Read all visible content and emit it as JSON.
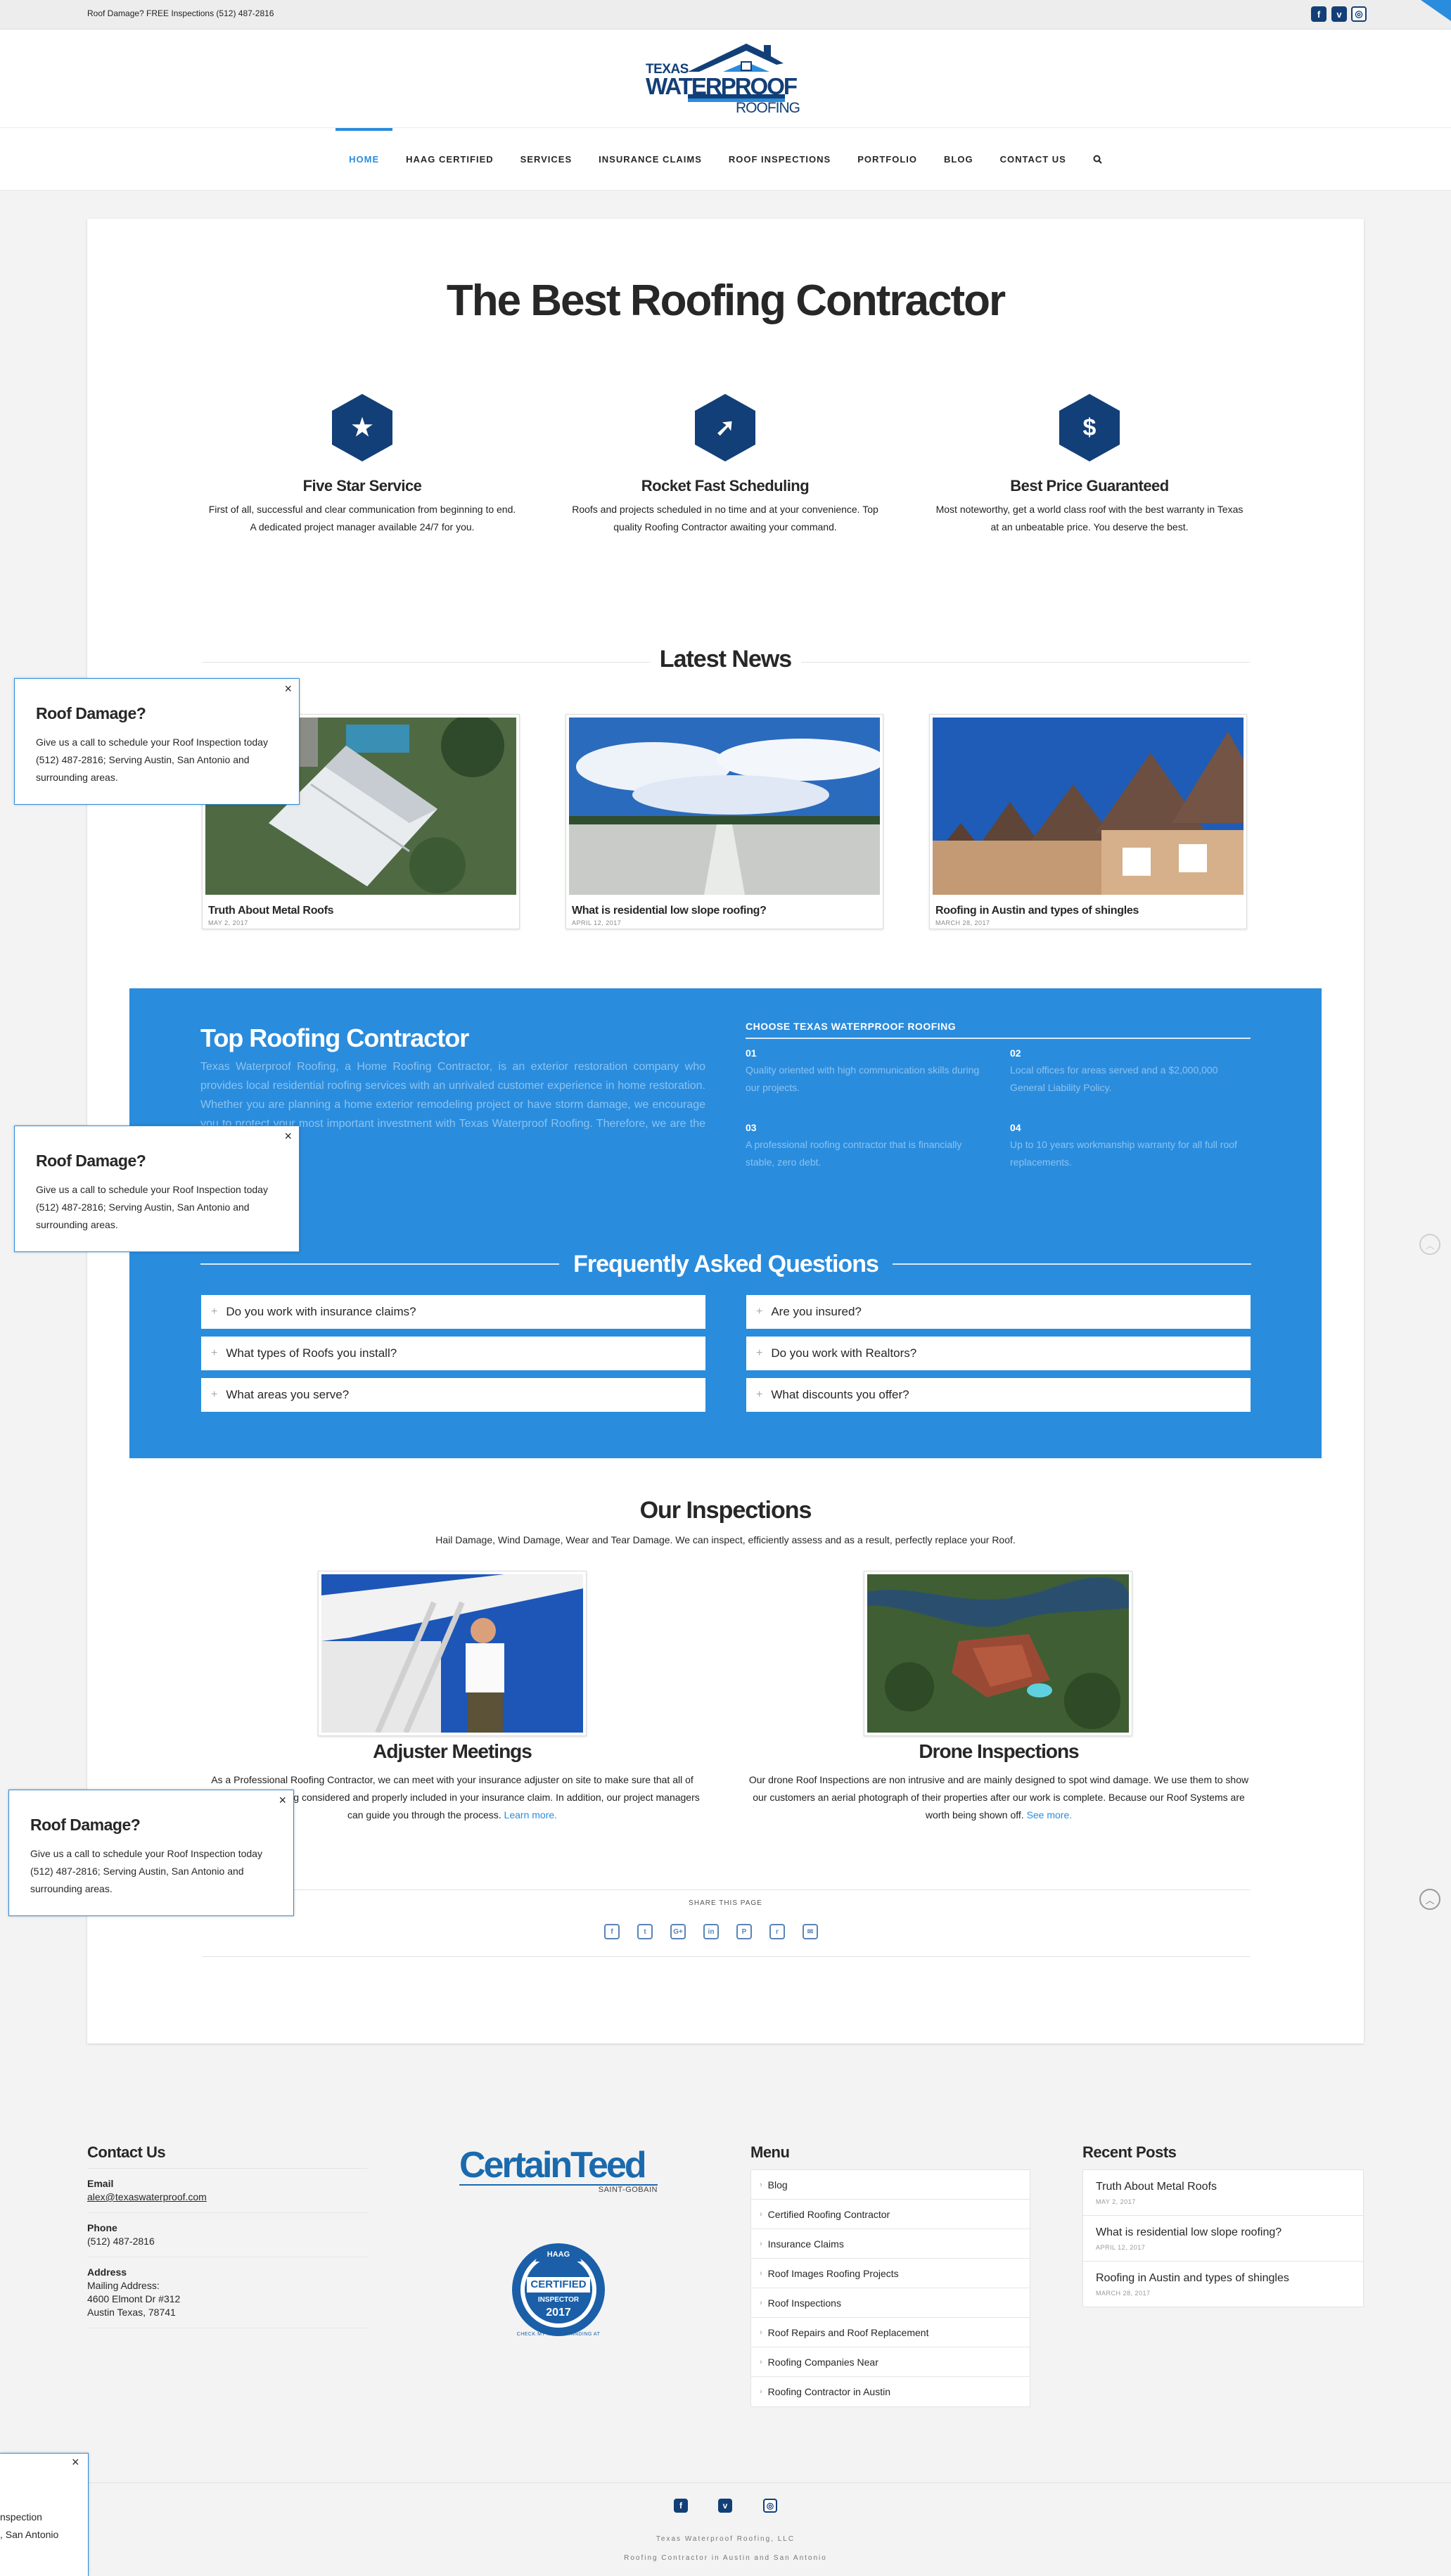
{
  "topbar": {
    "message": "Roof Damage? FREE Inspections (512) 487-2816",
    "social": [
      {
        "icon": "facebook-icon",
        "glyph": "f"
      },
      {
        "icon": "vimeo-icon",
        "glyph": "v"
      },
      {
        "icon": "instagram-icon",
        "glyph": "◎"
      }
    ]
  },
  "logo": {
    "line1": "TEXAS",
    "line2": "WATERPROOF",
    "line3": "ROOFING"
  },
  "nav": [
    "HOME",
    "HAAG CERTIFIED",
    "SERVICES",
    "INSURANCE CLAIMS",
    "ROOF INSPECTIONS",
    "PORTFOLIO",
    "BLOG",
    "CONTACT US"
  ],
  "hero": {
    "title": "The Best Roofing Contractor"
  },
  "features": [
    {
      "icon": "star-icon",
      "glyph": "★",
      "title": "Five Star Service",
      "text": "First of all, successful and clear communication from beginning to end. A dedicated project manager available 24/7 for you."
    },
    {
      "icon": "rocket-icon",
      "glyph": "➚",
      "title": "Rocket Fast Scheduling",
      "text": "Roofs and projects scheduled in no time and at your convenience. Top quality Roofing Contractor awaiting your command."
    },
    {
      "icon": "dollar-icon",
      "glyph": "$",
      "title": "Best Price Guaranteed",
      "text": "Most noteworthy, get a world class roof with the best warranty in Texas at an unbeatable price. You deserve the best."
    }
  ],
  "news": {
    "title": "Latest News",
    "posts": [
      {
        "title": "Truth About Metal Roofs",
        "date": "MAY 2, 2017"
      },
      {
        "title": "What is residential low slope roofing?",
        "date": "APRIL 12, 2017"
      },
      {
        "title": "Roofing in Austin and types of shingles",
        "date": "MARCH 28, 2017"
      }
    ]
  },
  "contractor": {
    "title": "Top Roofing Contractor",
    "text": "Texas Waterproof Roofing, a Home Roofing Contractor, is an exterior restoration company who provides local residential roofing services with an unrivaled customer experience in home restoration. Whether you are planning a home exterior remodeling project or have storm damage, we encourage you to protect your most important investment with Texas Waterproof Roofing. Therefore, we are the best roofer in town.",
    "choose_title": "CHOOSE TEXAS WATERPROOF ROOFING",
    "reasons": [
      {
        "num": "01",
        "text": "Quality oriented with high communication skills during our projects."
      },
      {
        "num": "02",
        "text": "Local offices for areas served and a $2,000,000 General Liability Policy."
      },
      {
        "num": "03",
        "text": "A professional roofing contractor that is financially stable, zero debt."
      },
      {
        "num": "04",
        "text": "Up to 10 years workmanship warranty for all full roof replacements."
      }
    ]
  },
  "faq": {
    "title": "Frequently Asked Questions",
    "items": [
      "Do you work with insurance claims?",
      "Are you insured?",
      "What types of Roofs you install?",
      "Do you work with Realtors?",
      "What areas you serve?",
      "What discounts you offer?"
    ]
  },
  "inspections": {
    "title": "Our Inspections",
    "subtitle": "Hail Damage, Wind Damage, Wear and Tear Damage. We can inspect, efficiently assess and as a result, perfectly replace your Roof.",
    "items": [
      {
        "title": "Adjuster Meetings",
        "text": "As a Professional Roofing Contractor, we can meet with your insurance adjuster on site to make sure that all of your damage is being considered and properly included in your insurance claim. In addition, our project managers can guide you through the process.",
        "link": "Learn more."
      },
      {
        "title": "Drone Inspections",
        "text": "Our drone Roof Inspections are non intrusive and are mainly designed to spot wind damage. We use them to show our customers an aerial photograph of their properties after our work is complete. Because our Roof Systems are worth being shown off.",
        "link": "See more."
      }
    ]
  },
  "share": {
    "label": "SHARE THIS PAGE",
    "icons": [
      {
        "icon": "facebook-share-icon",
        "glyph": "f"
      },
      {
        "icon": "twitter-share-icon",
        "glyph": "t"
      },
      {
        "icon": "google-plus-share-icon",
        "glyph": "G+"
      },
      {
        "icon": "linkedin-share-icon",
        "glyph": "in"
      },
      {
        "icon": "pinterest-share-icon",
        "glyph": "P"
      },
      {
        "icon": "reddit-share-icon",
        "glyph": "r"
      },
      {
        "icon": "email-share-icon",
        "glyph": "✉"
      }
    ]
  },
  "popup": {
    "title": "Roof Damage?",
    "text": "Give us a call to schedule your Roof Inspection today (512) 487-2816; Serving Austin, San Antonio and surrounding areas.",
    "close": "×",
    "clipped_lines": [
      "nspection",
      ", San Antonio"
    ]
  },
  "footer": {
    "contact": {
      "title": "Contact Us",
      "email_label": "Email",
      "email": "alex@texaswaterproof.com",
      "phone_label": "Phone",
      "phone": "(512) 487-2816",
      "address_label": "Address",
      "address_lines": [
        "Mailing Address:",
        "4600 Elmont Dr #312",
        "Austin Texas, 78741"
      ]
    },
    "certainteed": {
      "name": "CertainTeed",
      "sub": "SAINT-GOBAIN"
    },
    "haag": {
      "top": "HAAG",
      "line1": "CERTIFIED",
      "line2": "INSPECTOR",
      "year": "2017",
      "ring": "CHECK MY HAAG STANDING AT"
    },
    "menu": {
      "title": "Menu",
      "items": [
        "Blog",
        "Certified Roofing Contractor",
        "Insurance Claims",
        "Roof Images Roofing Projects",
        "Roof Inspections",
        "Roof Repairs and Roof Replacement",
        "Roofing Companies Near",
        "Roofing Contractor in Austin"
      ]
    },
    "recent": {
      "title": "Recent Posts",
      "posts": [
        {
          "title": "Truth About Metal Roofs",
          "date": "MAY 2, 2017"
        },
        {
          "title": "What is residential low slope roofing?",
          "date": "APRIL 12, 2017"
        },
        {
          "title": "Roofing in Austin and types of shingles",
          "date": "MARCH 28, 2017"
        }
      ]
    },
    "social": [
      {
        "icon": "facebook-icon",
        "glyph": "f"
      },
      {
        "icon": "vimeo-icon",
        "glyph": "v"
      },
      {
        "icon": "instagram-icon",
        "glyph": "◎"
      }
    ],
    "copyright": "Texas Waterproof Roofing, LLC",
    "tagline": "Roofing Contractor in Austin and San Antonio"
  },
  "colors": {
    "accent": "#2a8cdd",
    "navy": "#123f78"
  }
}
